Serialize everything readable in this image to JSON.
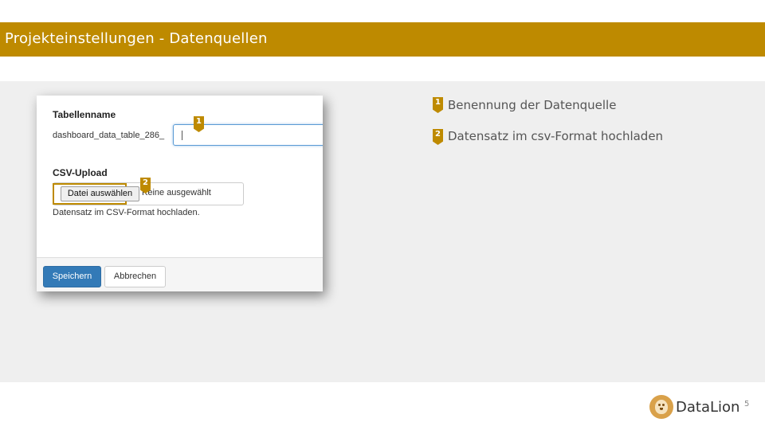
{
  "slide": {
    "title": "Projekteinstellungen - Datenquellen",
    "page_number": "5",
    "brand": "DataLion",
    "accent_color": "#be8a00"
  },
  "form": {
    "table_label": "Tabellenname",
    "table_prefix": "dashboard_data_table_286_",
    "table_value": "",
    "csv_label": "CSV-Upload",
    "file_button": "Datei auswählen",
    "file_status": "Keine ausgewählt",
    "help_text": "Datensatz im CSV-Format hochladen.",
    "save_button": "Speichern",
    "cancel_button": "Abbrechen"
  },
  "markers": [
    "1",
    "2"
  ],
  "legend": [
    {
      "number": "1",
      "text": "Benennung der Datenquelle"
    },
    {
      "number": "2",
      "text": "Datensatz im csv-Format hochladen"
    }
  ]
}
